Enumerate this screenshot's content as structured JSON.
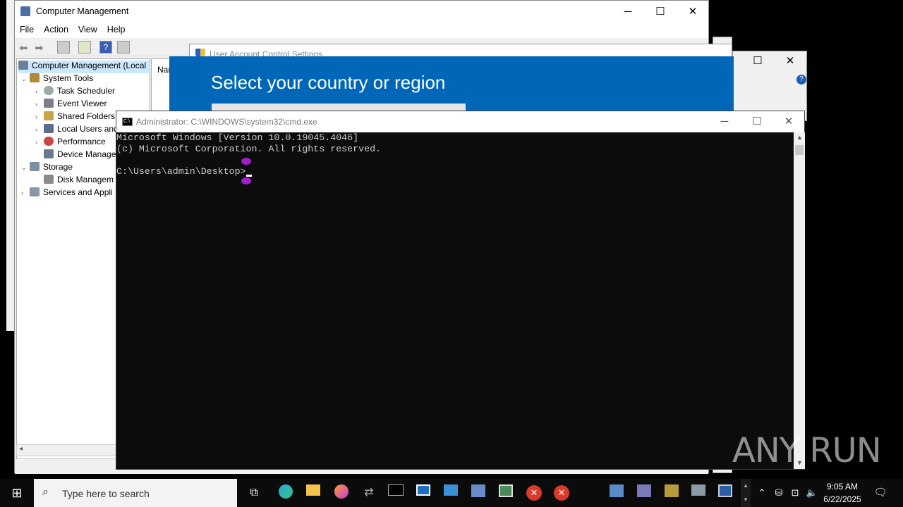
{
  "computer_management": {
    "title": "Computer Management",
    "menu": [
      "File",
      "Action",
      "View",
      "Help"
    ],
    "tree": [
      {
        "label": "Computer Management (Local",
        "level": 0,
        "expander": ""
      },
      {
        "label": "System Tools",
        "level": 1,
        "expander": "⌄"
      },
      {
        "label": "Task Scheduler",
        "level": 2,
        "expander": "›"
      },
      {
        "label": "Event Viewer",
        "level": 2,
        "expander": "›"
      },
      {
        "label": "Shared Folders",
        "level": 2,
        "expander": "›"
      },
      {
        "label": "Local Users and",
        "level": 2,
        "expander": "›"
      },
      {
        "label": "Performance",
        "level": 2,
        "expander": "›"
      },
      {
        "label": "Device Manager",
        "level": 2,
        "expander": ""
      },
      {
        "label": "Storage",
        "level": 1,
        "expander": "⌄"
      },
      {
        "label": "Disk Managem",
        "level": 2,
        "expander": ""
      },
      {
        "label": "Services and Appli",
        "level": 1,
        "expander": "›"
      }
    ],
    "right_header": "Nar"
  },
  "uac": {
    "title": "User Account Control Settings"
  },
  "oobe": {
    "heading": "Select your country or region"
  },
  "cmd": {
    "title": "Administrator: C:\\WINDOWS\\system32\\cmd.exe",
    "lines": [
      "Microsoft Windows [Version 10.0.19045.4046]",
      "(c) Microsoft Corporation. All rights reserved.",
      "",
      "C:\\Users\\admin\\Desktop>"
    ]
  },
  "taskbar": {
    "search_placeholder": "Type here to search",
    "time": "9:05 AM",
    "date": "6/22/2025"
  },
  "watermark": "ANY RUN"
}
